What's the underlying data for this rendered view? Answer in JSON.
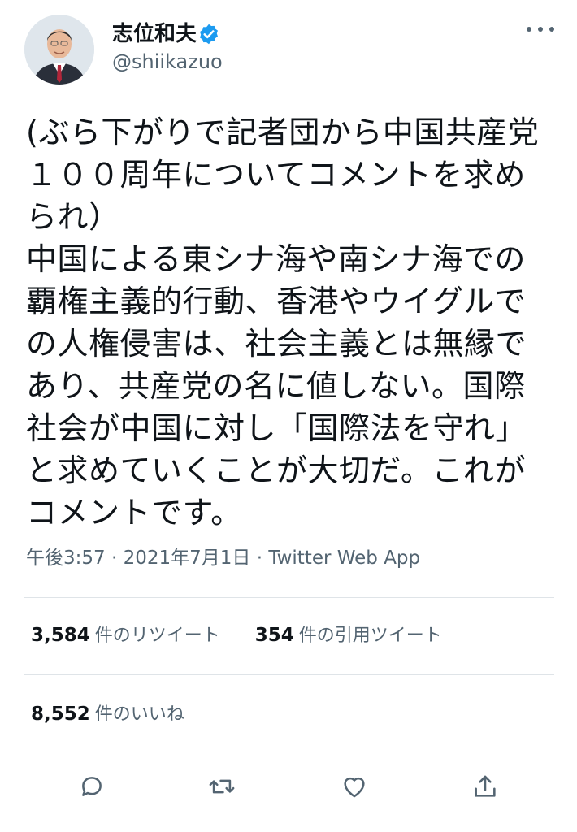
{
  "user": {
    "display_name": "志位和夫",
    "username": "@shiikazuo",
    "verified": true
  },
  "tweet": {
    "text": "(ぶら下がりで記者団から中国共産党\n１００周年についてコメントを求め\nられ）\n中国による東シナ海や南シナ海での\n覇権主義的行動、香港やウイグルで\nの人権侵害は、社会主義とは無縁で\nあり、共産党の名に値しない。国際\n社会が中国に対し「国際法を守れ」\nと求めていくことが大切だ。これが\nコメントです。",
    "time": "午後3:57",
    "separator": "·",
    "date": "2021年7月1日",
    "source": "Twitter Web App"
  },
  "stats": {
    "retweets_count": "3,584",
    "retweets_label": "件のリツイート",
    "quotes_count": "354",
    "quotes_label": "件の引用ツイート",
    "likes_count": "8,552",
    "likes_label": "件のいいね"
  },
  "icons": {
    "verified": "verified-badge-icon",
    "more": "more-icon",
    "reply": "reply-icon",
    "retweet": "retweet-icon",
    "like": "like-icon",
    "share": "share-icon"
  },
  "colors": {
    "text": "#0f1419",
    "secondary": "#536471",
    "verified": "#1d9bf0",
    "divider": "#dfe4e8"
  }
}
